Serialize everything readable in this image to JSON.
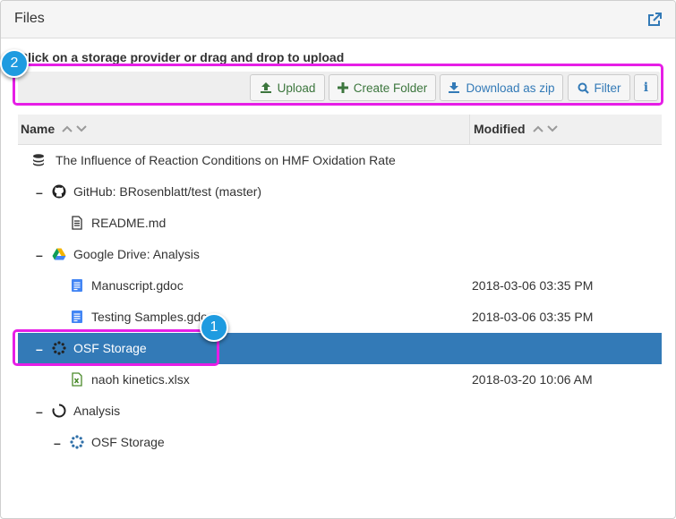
{
  "panel": {
    "title": "Files"
  },
  "instructions": "Click on a storage provider or drag and drop to upload",
  "toolbar": {
    "upload": "Upload",
    "create_folder": "Create Folder",
    "download_zip": "Download as zip",
    "filter": "Filter",
    "info": "i"
  },
  "columns": {
    "name": "Name",
    "modified": "Modified"
  },
  "rows": [
    {
      "label": "The Influence of Reaction Conditions on HMF Oxidation Rate",
      "toggle": "",
      "icon": "project-stack-icon",
      "modified": ""
    },
    {
      "label": "GitHub: BRosenblatt/test (master)",
      "toggle": "–",
      "icon": "github-icon",
      "modified": ""
    },
    {
      "label": "README.md",
      "toggle": "",
      "icon": "file-text-icon",
      "modified": ""
    },
    {
      "label": "Google Drive: Analysis",
      "toggle": "–",
      "icon": "google-drive-icon",
      "modified": ""
    },
    {
      "label": "Manuscript.gdoc",
      "toggle": "",
      "icon": "google-doc-icon",
      "modified": "2018-03-06 03:35 PM"
    },
    {
      "label": "Testing Samples.gdoc",
      "toggle": "",
      "icon": "google-doc-icon",
      "modified": "2018-03-06 03:35 PM"
    },
    {
      "label": "OSF Storage",
      "toggle": "–",
      "icon": "osf-storage-icon",
      "modified": ""
    },
    {
      "label": "naoh kinetics.xlsx",
      "toggle": "",
      "icon": "excel-file-icon",
      "modified": "2018-03-20 10:06 AM"
    },
    {
      "label": "Analysis",
      "toggle": "–",
      "icon": "osf-component-icon",
      "modified": ""
    },
    {
      "label": "OSF Storage",
      "toggle": "–",
      "icon": "osf-storage-icon",
      "modified": ""
    }
  ],
  "callouts": {
    "one": "1",
    "two": "2"
  },
  "colors": {
    "selection": "#337ab7",
    "highlight": "#e61ee6",
    "badge": "#1e9be0"
  }
}
